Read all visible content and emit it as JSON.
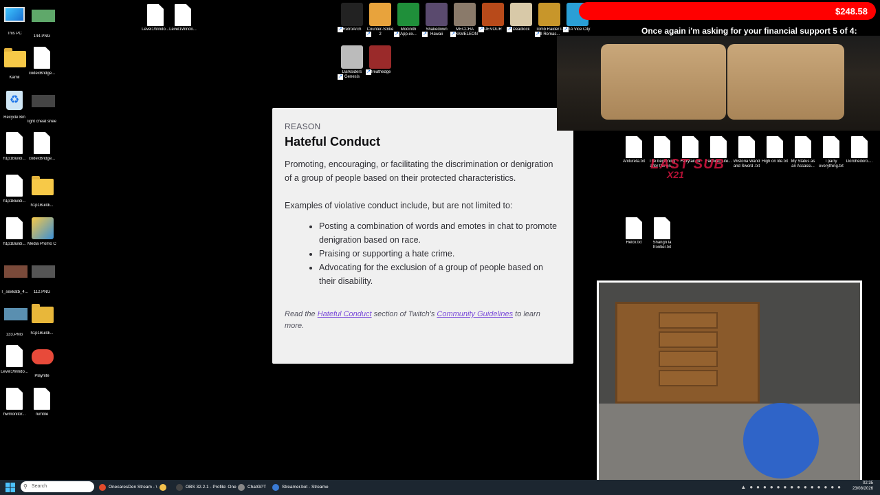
{
  "desktop_left": [
    {
      "label": "This PC",
      "type": "monitor"
    },
    {
      "label": "144.PNG",
      "type": "thumb-green"
    },
    {
      "label": "Kamil",
      "type": "folder-user"
    },
    {
      "label": "codexBridge...",
      "type": "doc"
    },
    {
      "label": "Recycle Bin",
      "type": "recycle"
    },
    {
      "label": "light cheat sheet.webp",
      "type": "thumb-gray"
    },
    {
      "label": "h1p1Buildi...",
      "type": "doc"
    },
    {
      "label": "codexBridge...",
      "type": "doc"
    },
    {
      "label": "h1p1Buildi...",
      "type": "doc"
    },
    {
      "label": "h1p1Buildi...",
      "type": "folder"
    },
    {
      "label": "h1p1Buildi...",
      "type": "doc"
    },
    {
      "label": "Media Promo Collector X...",
      "type": "app-media"
    },
    {
      "label": "T_sexkatb_4...",
      "type": "thumb-brown"
    },
    {
      "label": "112.PNG",
      "type": "thumb-darkgray"
    },
    {
      "label": "133.PNG",
      "type": "thumb-blue"
    },
    {
      "label": "h1p1Buildi...",
      "type": "folder-dark"
    },
    {
      "label": "Level1Windo...",
      "type": "doc"
    },
    {
      "label": "Playnite",
      "type": "app-playnite"
    },
    {
      "label": "hwmonitor...",
      "type": "doc"
    },
    {
      "label": "rumble",
      "type": "doc"
    }
  ],
  "desktop_top_docs": [
    "Level1Windo...",
    "Level1Windo..."
  ],
  "desktop_games": [
    {
      "label": "RetroArch",
      "color": "#222"
    },
    {
      "label": "Counter-Strike 2",
      "color": "#e8a33c"
    },
    {
      "label": "Modinith App.ex...",
      "color": "#1f8f3a"
    },
    {
      "label": "Shakedown Hawaii",
      "color": "#5a4a6e"
    },
    {
      "label": "MECCHA CHAMELEON",
      "color": "#8a7a6a"
    },
    {
      "label": "DEVOUR",
      "color": "#b84a1a"
    },
    {
      "label": "Deadlock",
      "color": "#d8c9a8"
    },
    {
      "label": "Tomb Raider I-III Remas...",
      "color": "#c8962a"
    },
    {
      "label": "GTA Vice City",
      "color": "#2a9fd6"
    },
    {
      "label": "Darksiders Genesis",
      "color": "#bbbbbb"
    },
    {
      "label": "Breathedge",
      "color": "#9a2a2a"
    }
  ],
  "desktop_right_docs": [
    "Anifureta.txt",
    "The beginning after the en...",
    "Fairytail.txt",
    "Farming Life...",
    "Wistoria Wand and Sword .txt",
    "High on life.txt",
    "My Status as an Assassi...",
    "I parry everything.txt",
    "Dorohedoro...."
  ],
  "desktop_right_docs2": [
    "Helck.txt",
    "Shangri la frontier.txt"
  ],
  "reason_card": {
    "kicker": "REASON",
    "title": "Hateful Conduct",
    "description": "Promoting, encouraging, or facilitating the discrimination or denigration of a group of people based on their protected characteristics.",
    "examples_intro": "Examples of violative conduct include, but are not limited to:",
    "examples": [
      "Posting a combination of words and emotes in chat to promote denigration based on race.",
      "Praising or supporting a hate crime.",
      "Advocating for the exclusion of a group of people based on their disability."
    ],
    "footer_pre": "Read the ",
    "footer_link1": "Hateful Conduct",
    "footer_mid": " section of Twitch's ",
    "footer_link2": "Community Guidelines",
    "footer_post": " to learn more."
  },
  "stream_overlay": {
    "goal_amount": "$248.58",
    "goal_message": "Once again i'm asking for your financial support 5 of 4:",
    "last_sub": "LAST SUB",
    "last_sub_name": "X21"
  },
  "taskbar": {
    "search_placeholder": "Search",
    "apps": [
      {
        "label": "OnecaresDen Stream - \\",
        "color": "#e34b2b"
      },
      {
        "label": "",
        "color": "#f2c04c"
      },
      {
        "label": "OBS 32.2.1 - Profile: One",
        "color": "#444"
      },
      {
        "label": "ChatGPT",
        "color": "#888"
      },
      {
        "label": "Streamer.bot - Streame",
        "color": "#3a7bd5"
      }
    ],
    "time": "02:35",
    "date": "23/08/2026"
  }
}
